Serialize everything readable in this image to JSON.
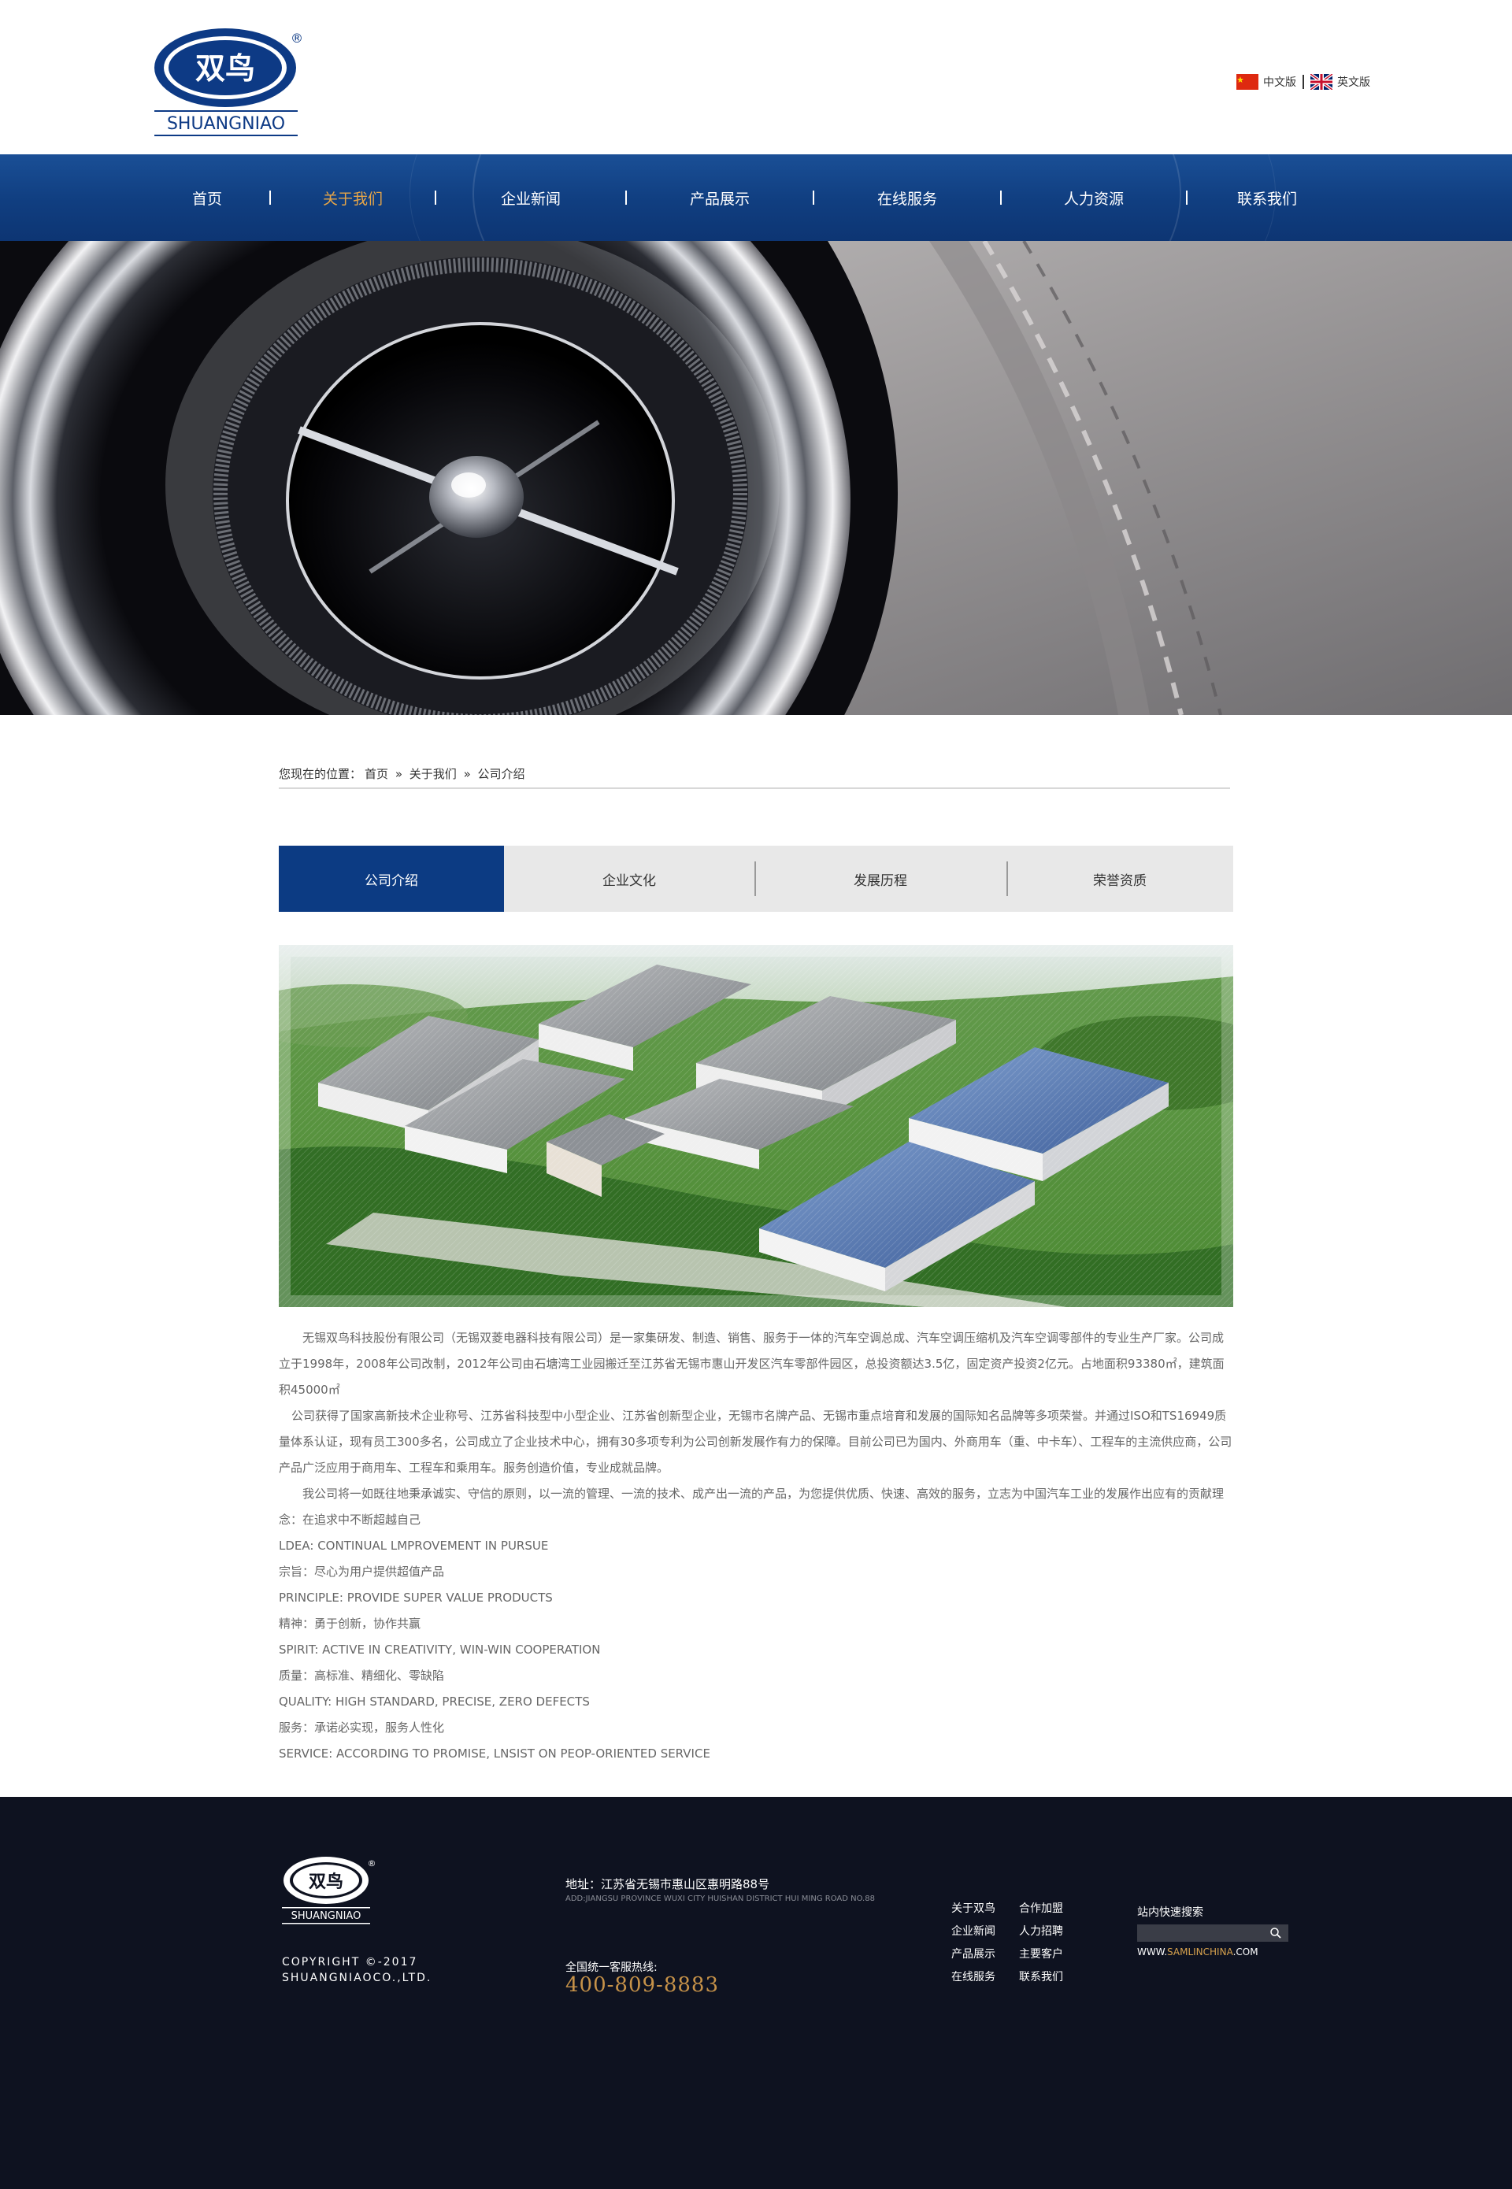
{
  "header": {
    "logo": {
      "mark_text": "双鸟",
      "brand_text": "SHUANGNIAO",
      "registered": "®"
    },
    "languages": [
      {
        "label": "中文版",
        "flag": "cn-flag-icon"
      },
      {
        "label": "英文版",
        "flag": "uk-flag-icon"
      }
    ]
  },
  "nav": {
    "items": [
      {
        "label": "首页"
      },
      {
        "label": "关于我们",
        "active": true
      },
      {
        "label": "企业新闻"
      },
      {
        "label": "产品展示"
      },
      {
        "label": "在线服务"
      },
      {
        "label": "人力资源"
      },
      {
        "label": "联系我们"
      }
    ]
  },
  "breadcrumb": {
    "prefix": "您现在的位置：",
    "items": [
      "首页",
      "关于我们",
      "公司介绍"
    ],
    "separator": "»"
  },
  "tabs": [
    {
      "label": "公司介绍",
      "active": true
    },
    {
      "label": "企业文化"
    },
    {
      "label": "发展历程"
    },
    {
      "label": "荣誉资质"
    }
  ],
  "article": {
    "paragraphs": [
      "无锡双鸟科技股份有限公司（无锡双菱电器科技有限公司）是一家集研发、制造、销售、服务于一体的汽车空调总成、汽车空调压缩机及汽车空调零部件的专业生产厂家。公司成立于1998年，2008年公司改制，2012年公司由石塘湾工业园搬迁至江苏省无锡市惠山开发区汽车零部件园区，总投资额达3.5亿，固定资产投资2亿元。占地面积93380㎡，建筑面积45000㎡",
      "公司获得了国家高新技术企业称号、江苏省科技型中小型企业、江苏省创新型企业，无锡市名牌产品、无锡市重点培育和发展的国际知名品牌等多项荣誉。并通过ISO和TS16949质量体系认证，现有员工300多名，公司成立了企业技术中心，拥有30多项专利为公司创新发展作有力的保障。目前公司已为国内、外商用车（重、中卡车）、工程车的主流供应商，公司产品广泛应用于商用车、工程车和乘用车。服务创造价值，专业成就品牌。",
      "我公司将一如既往地秉承诚实、守信的原则，以一流的管理、一流的技术、成产出一流的产品，为您提供优质、快速、高效的服务，立志为中国汽车工业的发展作出应有的贡献理念：在追求中不断超越自己"
    ],
    "lines": [
      "LDEA: CONTINUAL LMPROVEMENT IN PURSUE",
      "宗旨：尽心为用户提供超值产品",
      "PRINCIPLE: PROVIDE SUPER VALUE PRODUCTS",
      "精神：勇于创新，协作共赢",
      "SPIRIT: ACTIVE IN CREATIVITY, WIN-WIN COOPERATION",
      "质量：高标准、精细化、零缺陷",
      "QUALITY: HIGH STANDARD, PRECISE, ZERO DEFECTS",
      "服务：承诺必实现，服务人性化",
      "SERVICE: ACCORDING TO PROMISE, LNSIST ON PEOP-ORIENTED SERVICE"
    ]
  },
  "footer": {
    "logo_mark": "双鸟",
    "logo_brand": "SHUANGNIAO",
    "registered": "®",
    "copyright_line1": "COPYRIGHT ©-2017",
    "copyright_line2": "SHUANGNIAOCO.,LTD.",
    "address": "地址：江苏省无锡市惠山区惠明路88号",
    "address_en": "ADD:JIANGSU PROVINCE WUXI CITY HUISHAN DISTRICT HUI MING ROAD NO.88",
    "hotline_label": "全国统一客服热线:",
    "hotline": "400-809-8883",
    "links": [
      "关于双鸟",
      "合作加盟",
      "企业新闻",
      "人力招聘",
      "产品展示",
      "主要客户",
      "在线服务",
      "联系我们"
    ],
    "search_label": "站内快速搜索",
    "site_prefix": "WWW.",
    "site_highlight": "SAMLINCHINA",
    "site_suffix": ".COM"
  },
  "colors": {
    "nav_blue": "#103e80",
    "nav_active": "#e6a548",
    "tab_active": "#0c3b83",
    "footer_bg": "#0e1220",
    "hotline": "#c69249"
  }
}
